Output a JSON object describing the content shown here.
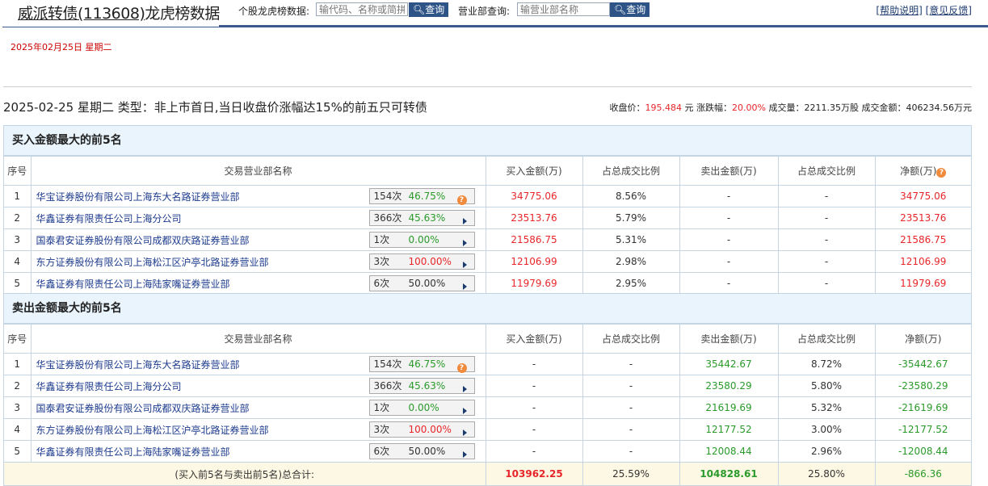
{
  "header": {
    "title_link": "威派转债(113608)",
    "title_suffix": "龙虎榜数据",
    "stock_label": "个股龙虎榜数据:",
    "stock_placeholder": "输代码、名称或简拼",
    "search_btn": "查询",
    "dept_label": "营业部查询:",
    "dept_placeholder": "输营业部名称",
    "help": "[帮助说明]",
    "feedback": "[意见反馈]"
  },
  "date": "2025年02月25日  星期二",
  "info": {
    "desc": "2025-02-25 星期二 类型：非上市首日,当日收盘价涨幅达15%的前五只可转债",
    "close_label": "收盘价：",
    "close": "195.484",
    "close_unit": " 元 ",
    "chg_label": "涨跌幅：",
    "chg": "20.00%",
    "vol_label": " 成交量：",
    "vol": "2211.35万股",
    "amt_label": " 成交金额：",
    "amt": "406234.56万元"
  },
  "columns": [
    "序号",
    "交易营业部名称",
    "买入金额(万)",
    "占总成交比例",
    "卖出金额(万)",
    "占总成交比例",
    "净额(万)"
  ],
  "buy": {
    "title": "买入金额最大的前5名",
    "rows": [
      {
        "no": "1",
        "name": "华宝证券股份有限公司上海东大名路证券营业部",
        "times": "154次",
        "pct": "46.75%",
        "pct_color": "green",
        "icon": "q",
        "buy": "34775.06",
        "buy_ratio": "8.56%",
        "sell": "-",
        "sell_ratio": "-",
        "net": "34775.06"
      },
      {
        "no": "2",
        "name": "华鑫证券有限责任公司上海分公司",
        "times": "366次",
        "pct": "45.63%",
        "pct_color": "green",
        "icon": "arrow",
        "buy": "23513.76",
        "buy_ratio": "5.79%",
        "sell": "-",
        "sell_ratio": "-",
        "net": "23513.76"
      },
      {
        "no": "3",
        "name": "国泰君安证券股份有限公司成都双庆路证券营业部",
        "times": "1次",
        "pct": "0.00%",
        "pct_color": "green",
        "icon": "arrow",
        "buy": "21586.75",
        "buy_ratio": "5.31%",
        "sell": "-",
        "sell_ratio": "-",
        "net": "21586.75"
      },
      {
        "no": "4",
        "name": "东方证券股份有限公司上海松江区沪亭北路证券营业部",
        "times": "3次",
        "pct": "100.00%",
        "pct_color": "red",
        "icon": "arrow",
        "buy": "12106.99",
        "buy_ratio": "2.98%",
        "sell": "-",
        "sell_ratio": "-",
        "net": "12106.99"
      },
      {
        "no": "5",
        "name": "华鑫证券有限责任公司上海陆家嘴证券营业部",
        "times": "6次",
        "pct": "50.00%",
        "pct_color": "gray",
        "icon": "arrow",
        "buy": "11979.69",
        "buy_ratio": "2.95%",
        "sell": "-",
        "sell_ratio": "-",
        "net": "11979.69"
      }
    ]
  },
  "sell": {
    "title": "卖出金额最大的前5名",
    "rows": [
      {
        "no": "1",
        "name": "华宝证券股份有限公司上海东大名路证券营业部",
        "times": "154次",
        "pct": "46.75%",
        "pct_color": "green",
        "icon": "q",
        "buy": "-",
        "buy_ratio": "-",
        "sell": "35442.67",
        "sell_ratio": "8.72%",
        "net": "-35442.67"
      },
      {
        "no": "2",
        "name": "华鑫证券有限责任公司上海分公司",
        "times": "366次",
        "pct": "45.63%",
        "pct_color": "green",
        "icon": "arrow",
        "buy": "-",
        "buy_ratio": "-",
        "sell": "23580.29",
        "sell_ratio": "5.80%",
        "net": "-23580.29"
      },
      {
        "no": "3",
        "name": "国泰君安证券股份有限公司成都双庆路证券营业部",
        "times": "1次",
        "pct": "0.00%",
        "pct_color": "green",
        "icon": "arrow",
        "buy": "-",
        "buy_ratio": "-",
        "sell": "21619.69",
        "sell_ratio": "5.32%",
        "net": "-21619.69"
      },
      {
        "no": "4",
        "name": "东方证券股份有限公司上海松江区沪亭北路证券营业部",
        "times": "3次",
        "pct": "100.00%",
        "pct_color": "red",
        "icon": "arrow",
        "buy": "-",
        "buy_ratio": "-",
        "sell": "12177.52",
        "sell_ratio": "3.00%",
        "net": "-12177.52"
      },
      {
        "no": "5",
        "name": "华鑫证券有限责任公司上海陆家嘴证券营业部",
        "times": "6次",
        "pct": "50.00%",
        "pct_color": "gray",
        "icon": "arrow",
        "buy": "-",
        "buy_ratio": "-",
        "sell": "12008.44",
        "sell_ratio": "2.96%",
        "net": "-12008.44"
      }
    ],
    "total": {
      "label": "(买入前5名与卖出前5名)总合计:",
      "buy": "103962.25",
      "buy_ratio": "25.59%",
      "sell": "104828.61",
      "sell_ratio": "25.80%",
      "net": "-866.36"
    }
  },
  "colors": {
    "red": "#e8262a",
    "green": "#2a9a2a",
    "blue": "#2e5487"
  }
}
